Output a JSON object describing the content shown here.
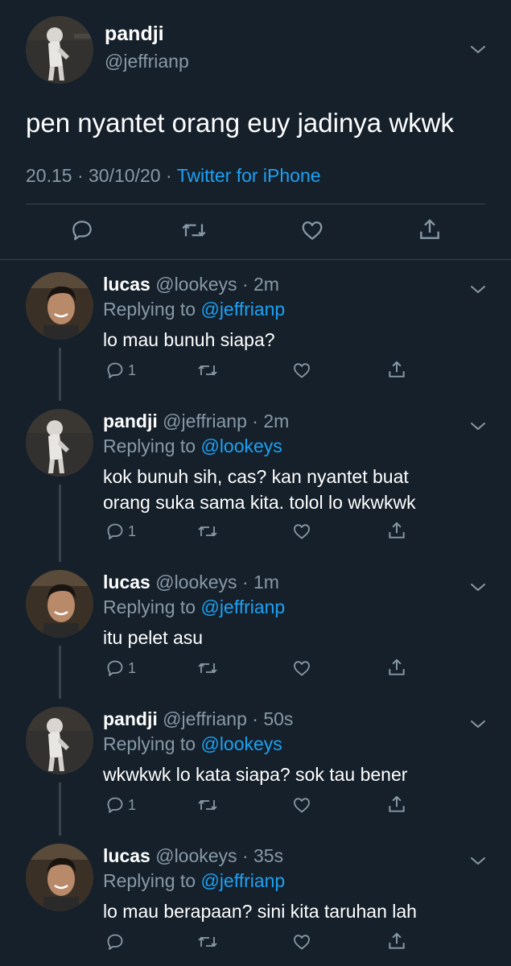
{
  "main_tweet": {
    "author_name": "pandji",
    "author_handle": "@jeffrianp",
    "text": "pen nyantet orang euy jadinya wkwk",
    "time": "20.15",
    "date": "30/10/20",
    "source": "Twitter for iPhone"
  },
  "icons": {
    "reply": "reply-icon",
    "retweet": "retweet-icon",
    "like": "like-icon",
    "share": "share-icon",
    "more": "chevron-down-icon"
  },
  "colors": {
    "background": "#15202b",
    "secondary_text": "#8899a6",
    "accent": "#1da1f2",
    "divider": "#38444d"
  },
  "replies": [
    {
      "name": "lucas",
      "handle": "@lookeys",
      "dot": "·",
      "time": "2m",
      "replying_prefix": "Replying to",
      "replying_to": "@jeffrianp",
      "lines": [
        "lo mau bunuh siapa?"
      ],
      "reply_count": "1"
    },
    {
      "name": "pandji",
      "handle": "@jeffrianp",
      "dot": "·",
      "time": "2m",
      "replying_prefix": "Replying to",
      "replying_to": "@lookeys",
      "lines": [
        "kok bunuh sih, cas? kan nyantet buat",
        "orang suka sama kita. tolol lo wkwkwk"
      ],
      "reply_count": "1"
    },
    {
      "name": "lucas",
      "handle": "@lookeys",
      "dot": "·",
      "time": "1m",
      "replying_prefix": "Replying to",
      "replying_to": "@jeffrianp",
      "lines": [
        "itu pelet asu"
      ],
      "reply_count": "1"
    },
    {
      "name": "pandji",
      "handle": "@jeffrianp",
      "dot": "·",
      "time": "50s",
      "replying_prefix": "Replying to",
      "replying_to": "@lookeys",
      "lines": [
        "wkwkwk lo kata siapa? sok tau bener"
      ],
      "reply_count": "1"
    },
    {
      "name": "lucas",
      "handle": "@lookeys",
      "dot": "·",
      "time": "35s",
      "replying_prefix": "Replying to",
      "replying_to": "@jeffrianp",
      "lines": [
        "lo mau berapaan? sini kita taruhan lah"
      ],
      "reply_count": ""
    }
  ]
}
